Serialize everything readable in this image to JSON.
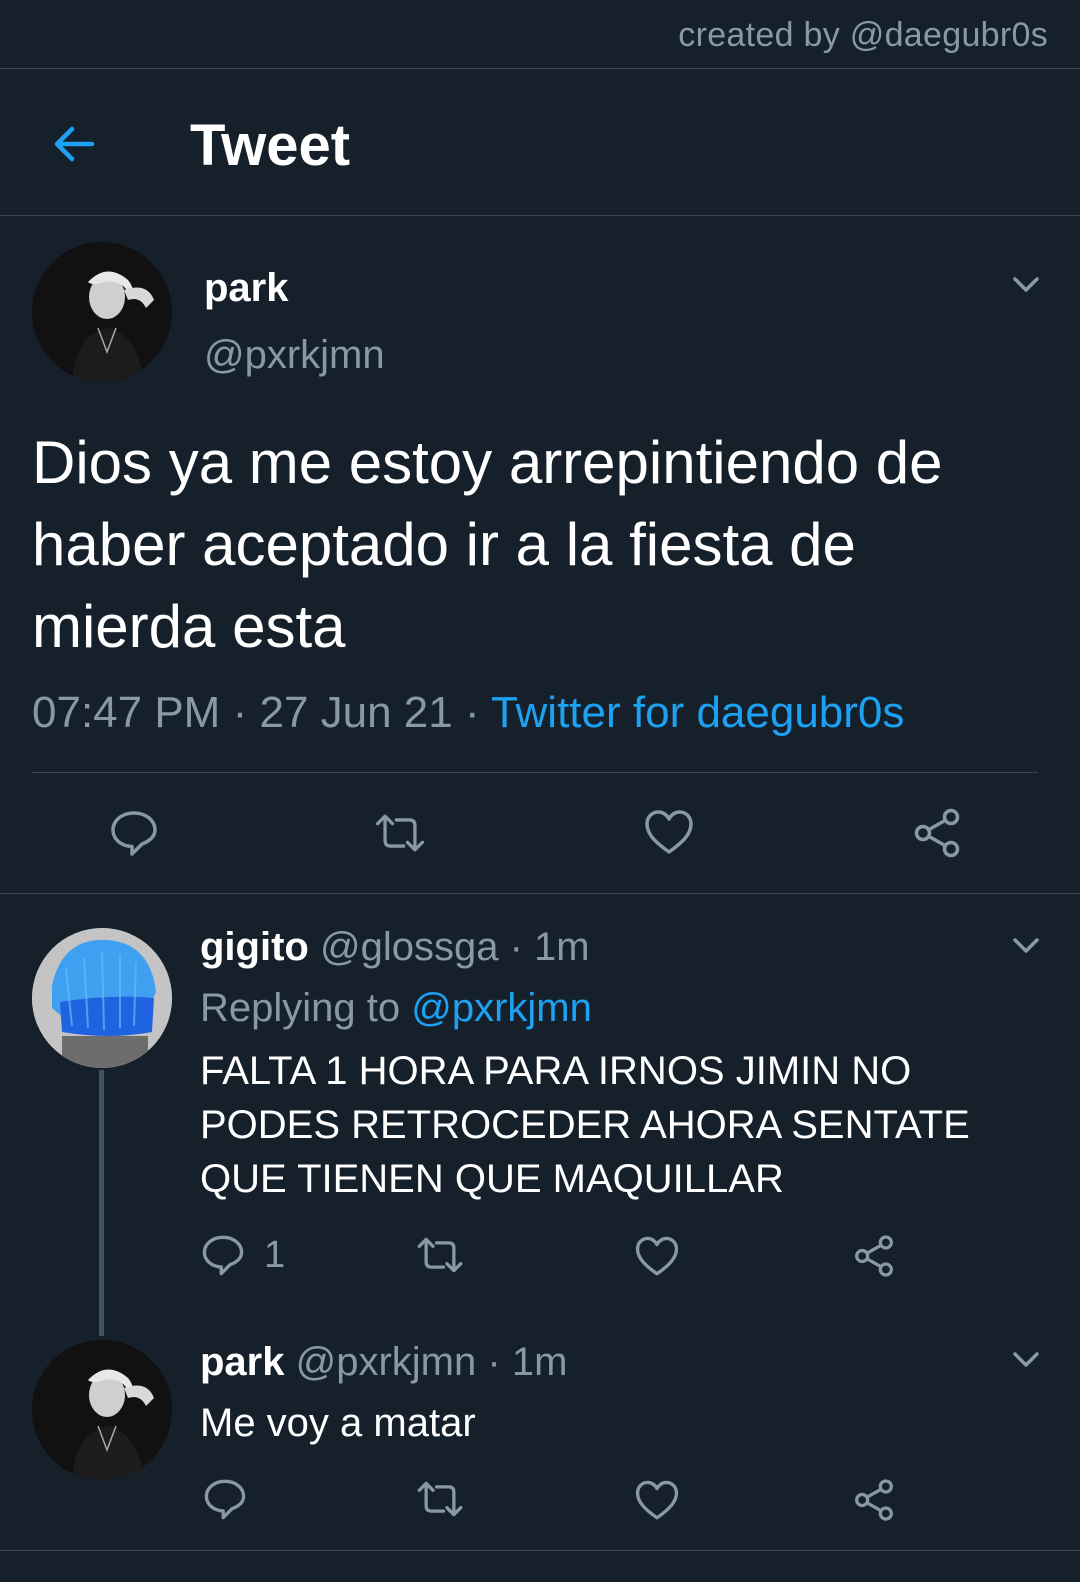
{
  "credit": "created by @daegubr0s",
  "header": {
    "title": "Tweet",
    "back_icon": "arrow-left-icon"
  },
  "main_tweet": {
    "name": "park",
    "handle": "@pxrkjmn",
    "text": "Dios ya me estoy arrepintiendo de haber aceptado ir a la fiesta de mierda esta",
    "time": "07:47 PM",
    "sep1": "·",
    "date": "27 Jun 21",
    "sep2": "·",
    "source": "Twitter for daegubr0s"
  },
  "replies": [
    {
      "name": "gigito",
      "handle": "@glossga",
      "dot": "·",
      "age": "1m",
      "replying_prefix": "Replying to",
      "replying_handle": "@pxrkjmn",
      "text": "FALTA 1 HORA PARA IRNOS JIMIN NO PODES RETROCEDER AHORA SENTATE QUE TIENEN QUE MAQUILLAR",
      "reply_count": "1"
    },
    {
      "name": "park",
      "handle": "@pxrkjmn",
      "dot": "·",
      "age": "1m",
      "text": "Me voy a matar"
    }
  ],
  "colors": {
    "background": "#15202b",
    "divider": "#38444d",
    "muted": "#8899a6",
    "accent": "#1da1f2"
  }
}
